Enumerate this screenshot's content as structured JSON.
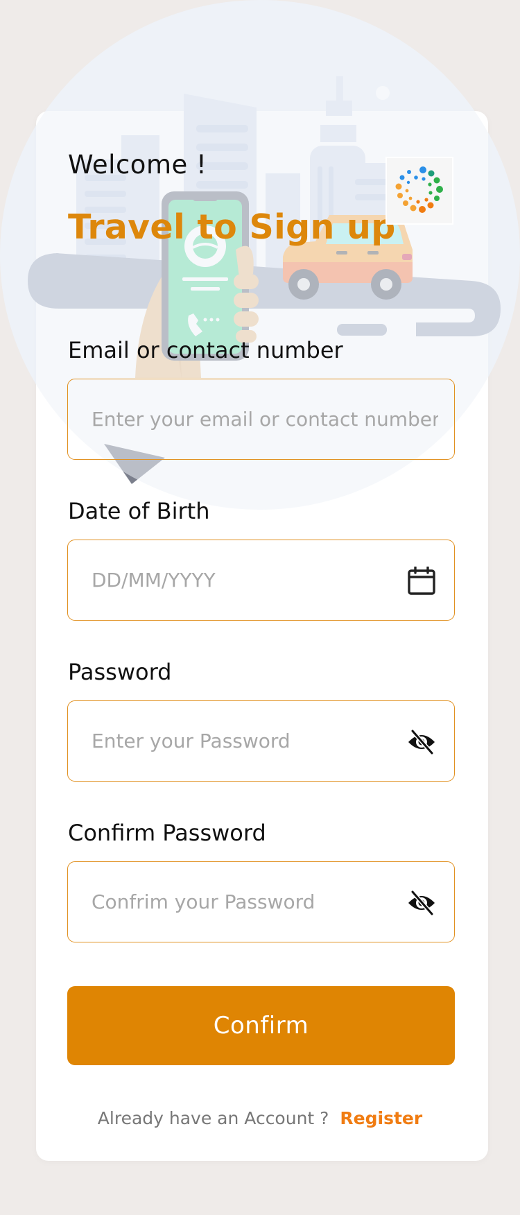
{
  "header": {
    "welcome": "Welcome !",
    "title": "Travel to Sign up"
  },
  "form": {
    "email": {
      "label": "Email or contact number",
      "placeholder": "Enter your email or contact number"
    },
    "dob": {
      "label": "Date of Birth",
      "placeholder": "DD/MM/YYYY"
    },
    "password": {
      "label": "Password",
      "placeholder": "Enter your Password"
    },
    "confirm_password": {
      "label": "Confirm Password",
      "placeholder": "Confrim your Password"
    },
    "submit_label": "Confirm"
  },
  "footer": {
    "prompt": "Already have an Account ?",
    "link": "Register"
  },
  "icons": {
    "calendar": "calendar-icon",
    "password_toggle": "eye-off-icon",
    "logo": "dotted-ring-logo"
  },
  "colors": {
    "accent": "#dd870b",
    "button": "#df8503",
    "link": "#f07c12",
    "field_border": "#e19121",
    "background": "#efebe9"
  }
}
